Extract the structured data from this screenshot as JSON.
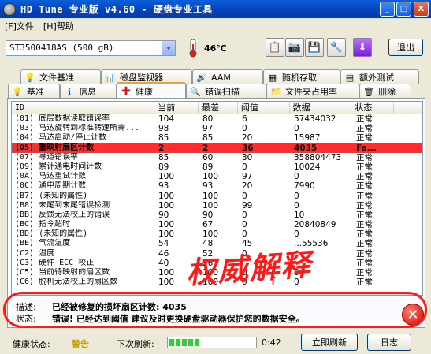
{
  "window": {
    "title": "HD Tune 专业版 v4.60 - 硬盘专业工具",
    "minimize": "_",
    "maximize": "□",
    "close": "X"
  },
  "menu": {
    "file": "[F]文件",
    "help": "[H]帮助"
  },
  "toolbar": {
    "drive": "ST3500418AS (500 gB)",
    "temperature": "46℃",
    "exit": "退出"
  },
  "tabs_top": [
    {
      "label": "文件基准"
    },
    {
      "label": "磁盘监视器"
    },
    {
      "label": "AAM"
    },
    {
      "label": "随机存取"
    },
    {
      "label": "额外测试"
    }
  ],
  "tabs_bottom": [
    {
      "label": "基准"
    },
    {
      "label": "信息"
    },
    {
      "label": "健康"
    },
    {
      "label": "错误扫描"
    },
    {
      "label": "文件夹占用率"
    },
    {
      "label": "删除"
    }
  ],
  "table": {
    "headers": {
      "id": "ID",
      "current": "当前",
      "worst": "最差",
      "threshold": "阈值",
      "data": "数据",
      "status": "状态"
    },
    "rows": [
      {
        "id": "(01) 底层数据读取错误率",
        "cur": "104",
        "worst": "80",
        "thr": "6",
        "data": "57434032",
        "status": "正常"
      },
      {
        "id": "(03) 马达旋转到标准转速所需...",
        "cur": "98",
        "worst": "97",
        "thr": "0",
        "data": "0",
        "status": "正常"
      },
      {
        "id": "(04) 马达启动/停止计数",
        "cur": "85",
        "worst": "85",
        "thr": "20",
        "data": "15987",
        "status": "正常"
      },
      {
        "id": "(05) 重映射扇区计数",
        "cur": "2",
        "worst": "2",
        "thr": "36",
        "data": "4035",
        "status": "Fa..."
      },
      {
        "id": "(07) 寻道错误率",
        "cur": "85",
        "worst": "60",
        "thr": "30",
        "data": "358804473",
        "status": "正常"
      },
      {
        "id": "(09) 累计通电时间计数",
        "cur": "89",
        "worst": "89",
        "thr": "0",
        "data": "10024",
        "status": "正常"
      },
      {
        "id": "(0A) 马达重试计数",
        "cur": "100",
        "worst": "100",
        "thr": "97",
        "data": "0",
        "status": "正常"
      },
      {
        "id": "(0C) 通电周期计数",
        "cur": "93",
        "worst": "93",
        "thr": "20",
        "data": "7990",
        "status": "正常"
      },
      {
        "id": "(B7) (未知的属性)",
        "cur": "100",
        "worst": "100",
        "thr": "0",
        "data": "0",
        "status": "正常"
      },
      {
        "id": "(B8) 未尾到末尾错误检测",
        "cur": "100",
        "worst": "100",
        "thr": "99",
        "data": "0",
        "status": "正常"
      },
      {
        "id": "(BB) 反馈无法校正的错误",
        "cur": "90",
        "worst": "90",
        "thr": "0",
        "data": "10",
        "status": "正常"
      },
      {
        "id": "(BC) 指令超时",
        "cur": "100",
        "worst": "67",
        "thr": "0",
        "data": "20840849",
        "status": "正常"
      },
      {
        "id": "(BD) (未知的属性)",
        "cur": "100",
        "worst": "100",
        "thr": "0",
        "data": "0",
        "status": "正常"
      },
      {
        "id": "(BE) 气流温度",
        "cur": "54",
        "worst": "48",
        "thr": "45",
        "data": "...55536",
        "status": "正常"
      },
      {
        "id": "(C2) 温度",
        "cur": "46",
        "worst": "52",
        "thr": "0",
        "data": "",
        "status": "正常"
      },
      {
        "id": "(C3) 硬件 ECC 校正",
        "cur": "40",
        "worst": "26",
        "thr": "",
        "data": "",
        "status": "正常"
      },
      {
        "id": "(C5) 当前待映射的扇区数",
        "cur": "100",
        "worst": "100",
        "thr": "0",
        "data": "0",
        "status": "正常"
      },
      {
        "id": "(C6) 脱机无法校正的扇区数",
        "cur": "100",
        "worst": "100",
        "thr": "0",
        "data": "0",
        "status": "正常"
      }
    ]
  },
  "annotation": {
    "text": "权威解释",
    "arrow": "↑"
  },
  "description": {
    "desc_label": "描述:",
    "desc_value": "已经被修复的损坏扇区计数: 4035",
    "status_label": "状态:",
    "status_value": "错误! 已经达到阈值 建议及时更换硬盘驱动器保护您的数据安全。"
  },
  "statusbar": {
    "health_label": "健康状态:",
    "health_value": "警告",
    "next_refresh_label": "下次刷新:",
    "progress_fraction": 0.35,
    "time": "0:42",
    "refresh_button": "立即刷新",
    "log_button": "日志"
  },
  "colors": {
    "highlight_row": "#ff2d2d",
    "annotation": "#ff1a1a",
    "warning": "#c9a400"
  }
}
